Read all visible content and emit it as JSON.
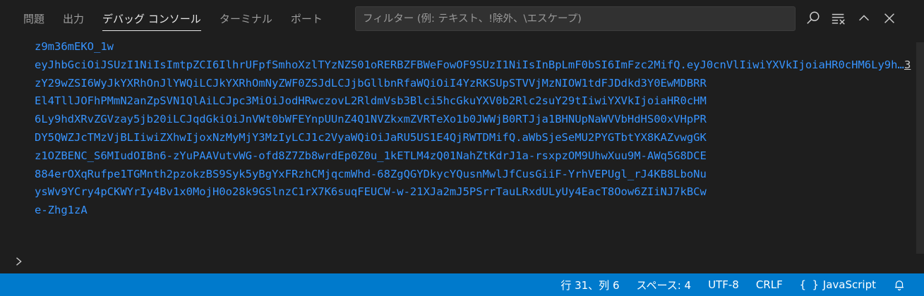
{
  "panel": {
    "tabs": [
      {
        "label": "問題"
      },
      {
        "label": "出力"
      },
      {
        "label": "デバッグ コンソール"
      },
      {
        "label": "ターミナル"
      },
      {
        "label": "ポート"
      }
    ],
    "active_tab": "デバッグ コンソール",
    "filter_placeholder": "フィルター (例: テキスト、!除外、\\エスケープ)"
  },
  "output": {
    "line_0": "z9m36mEKO_1w",
    "line_1": "eyJhbGciOiJSUzI1NiIsImtpZCI6IlhrUFpfSmhoXzlTYzNZS01oRERBZFBWeFowOF9SUzI1NiIsInBpLmF0bSI6ImFzc2MifQ.eyJ0cnVlIiwiYXVkIjoiaHR0cHM6Ly9hdXRvZGVzay5jb20iLCJqdGkiOiJnVWt0bWFEYnpUUnZ4Q1NVZkxmZVRTeXo1b0",
    "line_1_badge": "3",
    "lines": [
      "zY29wZSI6WyJkYXRhOnJlYWQiLCJkYXRhOmNyZWF0ZSJdLCJjbGllbnRfaWQiOiI4YzRKSUpSTVVjMzNIOW1tdFJDdkd3Y0EwMDBRR",
      "El4TllJOFhPMmN2anZpSVN1QlAiLCJpc3MiOiJodHRwczovL2RldmVsb3Blci5hcGkuYXV0b2Rlc2suY29tIiwiYXVkIjoiaHR0cHM",
      "6Ly9hdXRvZGVzay5jb20iLCJqdGkiOiJnVWt0bWFEYnpUUnZ4Q1NVZkxmZVRTeXo1b0JWWjB0RTJja1BHNUpNaWVVbHdHS00xVHpPR",
      "DY5QWZJcTMzVjBLIiwiZXhwIjoxNzMyMjY3MzIyLCJ1c2VyaWQiOiJaRU5US1E4QjRWTDMifQ.aWbSjeSeMU2PYGTbtYX8KAZvwgGK",
      "z1OZBENC_S6MIudOIBn6-zYuPAAVutvWG-ofd8Z7Zb8wrdEp0Z0u_1kETLM4zQ01NahZtKdrJ1a-rsxpzOM9UhwXuu9M-AWq5G8DCE",
      "884erOXqRufpe1TGMnth2pzokzBS9Syk5yBgYxFRzhCMjqcmWhd-68ZgQGYDkycYQusnMwlJfCusGiiF-YrhVEPUgl_rJ4KB8LboNu",
      "ysWv9YCry4pCKWYrIy4Bv1x0MojH0o28k9GSlnzC1rX7K6suqFEUCW-w-21XJa2mJ5PSrrTauLRxdULyUy4EacT8Oow6ZIiNJ7kBCw",
      "e-Zhg1zA"
    ]
  },
  "statusbar": {
    "position": "行 31、列 6",
    "spaces": "スペース: 4",
    "encoding": "UTF-8",
    "eol": "CRLF",
    "language_icon": "{ }",
    "language": "JavaScript"
  },
  "icons": {
    "search": "search-icon",
    "clear": "clear-console-icon",
    "maximize": "chevron-up-icon",
    "close": "close-icon",
    "prompt": "chevron-right-icon",
    "bell": "bell-icon"
  },
  "colors": {
    "background": "#1e1e1e",
    "output_text": "#3794ff",
    "statusbar": "#007acc"
  }
}
